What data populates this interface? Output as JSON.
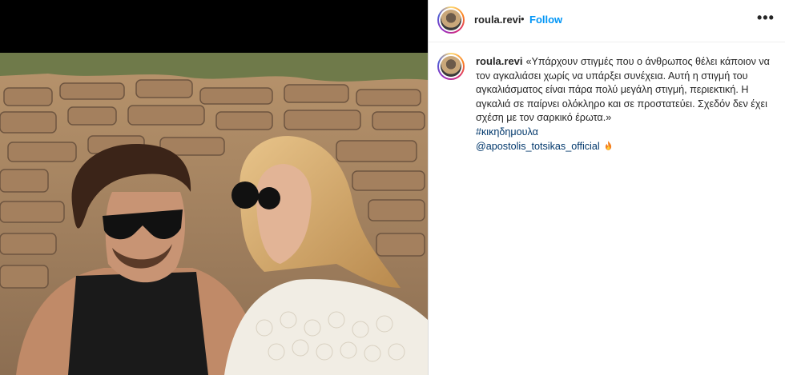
{
  "post": {
    "username": "roula.revi",
    "separator": "•",
    "follow_label": "Follow",
    "more_label": "•••"
  },
  "caption": {
    "username": "roula.revi",
    "text": "«Υπάρχουν στιγμές που ο άνθρωπος θέλει κάποιον να τον αγκαλιάσει χωρίς να υπάρξει συνέχεια. Αυτή η στιγμή του αγκαλιάσματος είναι πάρα πολύ μεγάλη στιγμή, περιεκτική. Η αγκαλιά σε παίρνει ολόκληρο και σε προστατεύει. Σχεδόν δεν έχει σχέση με τον σαρκικό έρωτα.»",
    "hashtag": "#κικηδημουλα",
    "mention": "@apostolis_totsikas_official",
    "emoji_icon": "fire-emoji"
  },
  "colors": {
    "link_blue": "#0095f6",
    "tag_color": "#00376b",
    "text": "#262626"
  }
}
